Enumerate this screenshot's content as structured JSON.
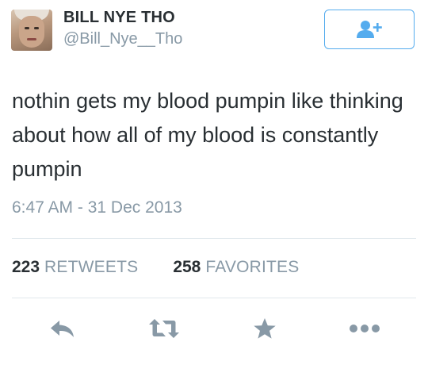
{
  "user": {
    "display_name": "BILL NYE THO",
    "handle": "@Bill_Nye__Tho"
  },
  "follow_button": {
    "icon": "add-user-icon",
    "color": "#55acee"
  },
  "tweet": {
    "text": "nothin gets my blood pumpin like thinking about how all of my blood is constantly pumpin",
    "timestamp": "6:47 AM - 31 Dec 2013"
  },
  "stats": {
    "retweets_count": "223",
    "retweets_label": "RETWEETS",
    "favorites_count": "258",
    "favorites_label": "FAVORITES"
  },
  "actions": [
    {
      "name": "reply",
      "icon": "reply-icon"
    },
    {
      "name": "retweet",
      "icon": "retweet-icon"
    },
    {
      "name": "favorite",
      "icon": "star-icon"
    },
    {
      "name": "more",
      "icon": "more-icon"
    }
  ],
  "colors": {
    "text": "#292f33",
    "secondary": "#8899a6",
    "accent": "#55acee",
    "icon": "#8899a6",
    "divider": "#e1e8ed"
  }
}
